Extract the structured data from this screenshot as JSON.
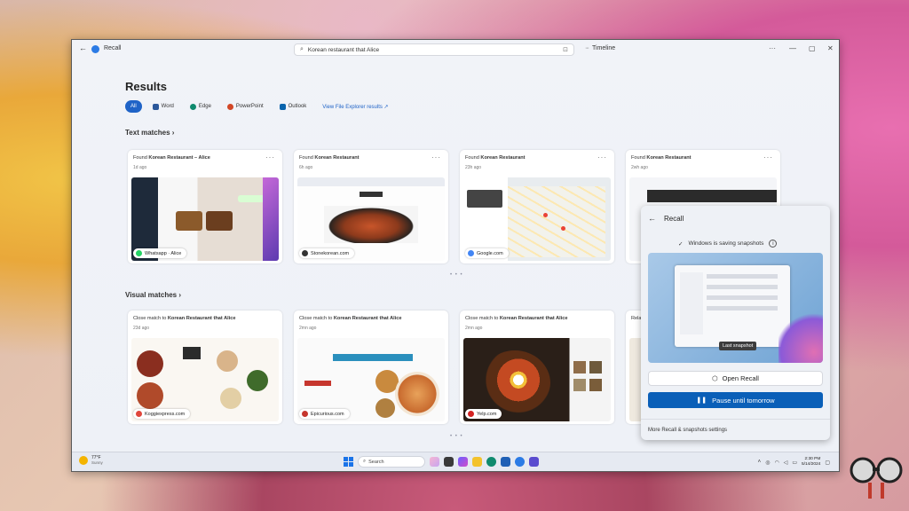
{
  "app": {
    "title": "Recall"
  },
  "search": {
    "query": "Korean restaurant that Alice"
  },
  "timeline_label": "Timeline",
  "results": {
    "title": "Results",
    "filters": [
      {
        "label": "All",
        "color": "#1f63c7"
      },
      {
        "label": "Word",
        "color": "#2b579a"
      },
      {
        "label": "Edge",
        "color": "#0f8a6e"
      },
      {
        "label": "PowerPoint",
        "color": "#d24726"
      },
      {
        "label": "Outlook",
        "color": "#0a64ad"
      }
    ],
    "file_explorer_link": "View File Explorer results ↗"
  },
  "text_matches": {
    "label": "Text matches",
    "cards": [
      {
        "prefix": "Found ",
        "bold": "Korean Restaurant – Alice",
        "sub": "1d ago",
        "source": "Whatsapp · Alice",
        "source_color": "#25d366"
      },
      {
        "prefix": "Found ",
        "bold": "Korean Restaurant",
        "sub": "6h ago",
        "source": "Stonekorean.com",
        "source_color": "#333333"
      },
      {
        "prefix": "Found ",
        "bold": "Korean Restaurant",
        "sub": "23h ago",
        "source": "Google.com",
        "source_color": "#4285f4"
      },
      {
        "prefix": "Found ",
        "bold": "Korean Restaurant",
        "sub": "2wh ago",
        "source": "",
        "source_color": "#888888"
      }
    ]
  },
  "visual_matches": {
    "label": "Visual matches",
    "cards": [
      {
        "prefix": "Close match to ",
        "bold": "Korean Restaurant that Alice",
        "sub": "23d ago",
        "source": "Koggiexpress.com",
        "source_color": "#e0463c"
      },
      {
        "prefix": "Close match to ",
        "bold": "Korean Restaurant that Alice",
        "sub": "2mn ago",
        "source": "Epicurious.com",
        "source_color": "#c6362e"
      },
      {
        "prefix": "Close match to ",
        "bold": "Korean Restaurant that Alice",
        "sub": "2mn ago",
        "source": "Yelp.com",
        "source_color": "#d32323"
      },
      {
        "prefix": "Relat",
        "bold": "",
        "sub": "",
        "source": "",
        "source_color": "#888888"
      }
    ]
  },
  "pager": "• • •",
  "flyout": {
    "title": "Recall",
    "status": "Windows is saving snapshots",
    "info": "i",
    "tooltip": "Last snapshot",
    "open_label": "Open Recall",
    "pause_label": "Pause until tomorrow",
    "more_label": "More Recall & snapshots settings"
  },
  "taskbar": {
    "weather_temp": "77°F",
    "weather_desc": "Sunny",
    "search_label": "Search",
    "time": "2:30 PM",
    "date": "5/14/2024"
  }
}
